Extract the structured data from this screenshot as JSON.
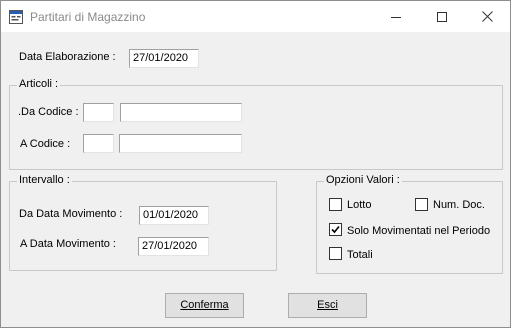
{
  "window": {
    "title": "Partitari di Magazzino"
  },
  "data_elaborazione": {
    "label": "Data Elaborazione :",
    "value": "27/01/2020"
  },
  "articoli": {
    "title": "Articoli :",
    "da_label": ".Da Codice :",
    "a_label": "A  Codice :",
    "da_code": "",
    "da_desc": "",
    "a_code": "",
    "a_desc": ""
  },
  "intervallo": {
    "title": "Intervallo :",
    "da_label": "Da Data Movimento  :",
    "da_value": "01/01/2020",
    "a_label": "A   Data Movimento :",
    "a_value": "27/01/2020"
  },
  "opzioni": {
    "title": "Opzioni Valori :",
    "lotto": {
      "label": "Lotto",
      "checked": false
    },
    "num_doc": {
      "label": "Num. Doc.",
      "checked": false
    },
    "solo_mov": {
      "label": "Solo Movimentati nel Periodo",
      "checked": true
    },
    "totali": {
      "label": "Totali",
      "checked": false
    }
  },
  "buttons": {
    "conferma": "Conferma",
    "esci": "Esci"
  }
}
